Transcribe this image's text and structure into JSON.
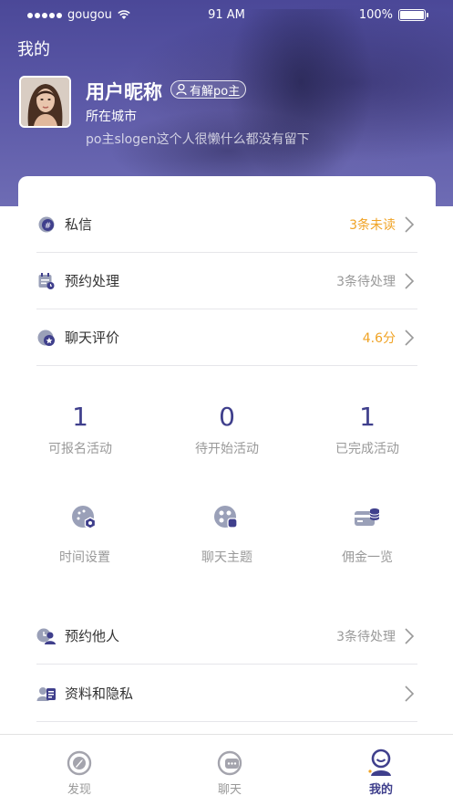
{
  "status_bar": {
    "carrier": "gougou",
    "time": "91 AM",
    "battery": "100%"
  },
  "header": {
    "title": "我的",
    "nickname": "用户昵称",
    "badge": "有解po主",
    "city": "所在城市",
    "slogan": "po主slogen这个人很懒什么都没有留下"
  },
  "menu_top": [
    {
      "icon": "message-icon",
      "label": "私信",
      "value": "3条未读",
      "value_color": "#f0a325"
    },
    {
      "icon": "calendar-icon",
      "label": "预约处理",
      "value": "3条待处理",
      "value_color": "#999999"
    },
    {
      "icon": "rating-icon",
      "label": "聊天评价",
      "value": "4.6分",
      "value_color": "#f0a325"
    }
  ],
  "stats": [
    {
      "number": "1",
      "label": "可报名活动"
    },
    {
      "number": "0",
      "label": "待开始活动"
    },
    {
      "number": "1",
      "label": "已完成活动"
    }
  ],
  "tools": [
    {
      "icon": "time-settings-icon",
      "label": "时间设置"
    },
    {
      "icon": "chat-topic-icon",
      "label": "聊天主题"
    },
    {
      "icon": "commission-icon",
      "label": "佣金一览"
    }
  ],
  "menu_bottom": [
    {
      "icon": "book-others-icon",
      "label": "预约他人",
      "value": "3条待处理"
    },
    {
      "icon": "privacy-icon",
      "label": "资料和隐私",
      "value": ""
    }
  ],
  "tabbar": [
    {
      "icon": "discover-icon",
      "label": "发现",
      "active": false
    },
    {
      "icon": "chat-icon",
      "label": "聊天",
      "active": false
    },
    {
      "icon": "profile-icon",
      "label": "我的",
      "active": true
    }
  ],
  "colors": {
    "accent": "#3f3f8c",
    "orange": "#f0a325",
    "header_bg": "#5a57a6"
  }
}
